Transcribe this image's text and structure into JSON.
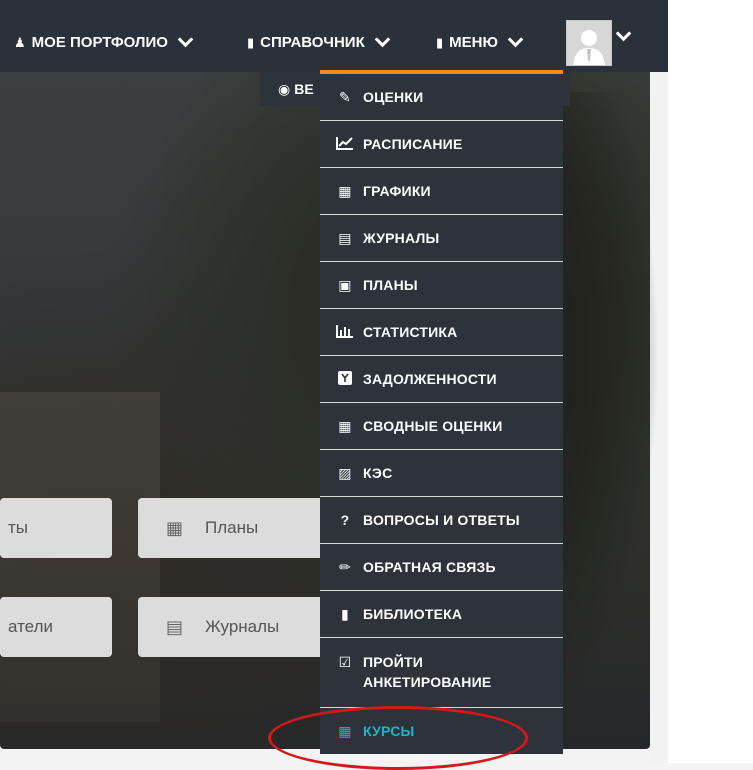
{
  "nav": {
    "portfolio": "МОЕ ПОРТФОЛИО",
    "reference": "СПРАВОЧНИК",
    "menu": "МЕНЮ"
  },
  "hero": {
    "button_label": "ВЕ",
    "tiles": [
      {
        "label": "ты"
      },
      {
        "label": "Планы"
      },
      {
        "label": "атели"
      },
      {
        "label": "Журналы"
      }
    ]
  },
  "dropdown": {
    "items": [
      {
        "label": "ОЦЕНКИ",
        "icon": "edit-icon"
      },
      {
        "label": "РАСПИСАНИЕ",
        "icon": "line-chart-icon"
      },
      {
        "label": "ГРАФИКИ",
        "icon": "calendar-icon"
      },
      {
        "label": "ЖУРНАЛЫ",
        "icon": "list-icon"
      },
      {
        "label": "ПЛАНЫ",
        "icon": "newspaper-icon"
      },
      {
        "label": "СТАТИСТИКА",
        "icon": "bar-chart-icon"
      },
      {
        "label": "ЗАДОЛЖЕННОСТИ",
        "icon": "badge-icon"
      },
      {
        "label": "СВОДНЫЕ ОЦЕНКИ",
        "icon": "book-open-icon"
      },
      {
        "label": "КЭС",
        "icon": "institution-icon"
      },
      {
        "label": "ВОПРОСЫ И ОТВЕТЫ",
        "icon": "question-icon"
      },
      {
        "label": "ОБРАТНАЯ СВЯЗЬ",
        "icon": "pencil-icon"
      },
      {
        "label": "БИБЛИОТЕКА",
        "icon": "book-icon"
      },
      {
        "label": "ПРОЙТИ АНКЕТИРОВАНИЕ",
        "icon": "check-square-icon"
      },
      {
        "label": "КУРСЫ",
        "icon": "calendar-icon"
      }
    ]
  },
  "colors": {
    "topbar": "#2b313a",
    "dropdown_bg": "#2d323b",
    "dropdown_accent": "#f28a1d",
    "active_item": "#1fb6c9",
    "highlight": "#d41919"
  }
}
